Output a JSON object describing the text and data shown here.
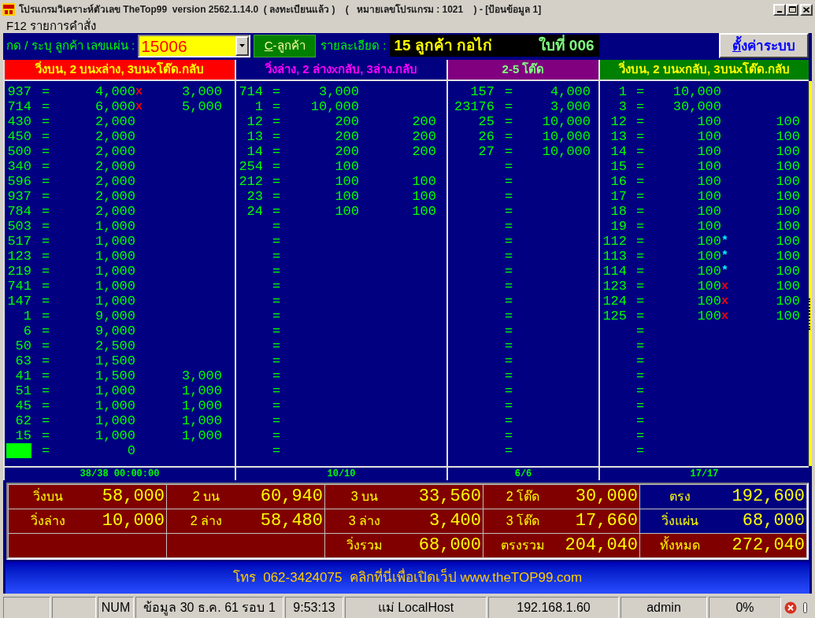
{
  "window": {
    "title": "โปรแกรมวิเคราะห์ตัวเลข TheTop99  version 2562.1.14.0  ( ลงทะเบียนแล้ว )    (   หมายเลขโปรแกรม : 1021    ) - [ป้อนข้อมูล 1]"
  },
  "menu": {
    "label": "F12 รายการคำสั่ง"
  },
  "toolbar": {
    "sheet_label": "กด / ระบุ ลูกค้า เลขแผ่น :",
    "sheet_number": {
      "value": "15006"
    },
    "customer_button": {
      "label": "C-ลูกค้า"
    },
    "detail_label": "รายละเอียด :",
    "detail": {
      "customer": "15 ลูกค้า กอไก่",
      "sheet": "ใบที่ 006"
    },
    "settings_button": {
      "label": "ตั้งค่าระบบ"
    }
  },
  "panels": [
    {
      "title": "วิ่งบน, 2 บนxล่าง, 3บนxโต๊ด.กลับ",
      "color": "#ff0000",
      "rows": [
        {
          "number": "937",
          "sign": "=",
          "amount": "4,000",
          "mark": {
            "symbol": "x",
            "color": "#ff0000"
          },
          "amount_2": "3,000"
        },
        {
          "number": "714",
          "sign": "=",
          "amount": "6,000",
          "mark": {
            "symbol": "x",
            "color": "#ff0000"
          },
          "amount_2": "5,000"
        },
        {
          "number": "430",
          "sign": "=",
          "amount": "2,000"
        },
        {
          "number": "450",
          "sign": "=",
          "amount": "2,000"
        },
        {
          "number": "500",
          "sign": "=",
          "amount": "2,000"
        },
        {
          "number": "340",
          "sign": "=",
          "amount": "2,000"
        },
        {
          "number": "596",
          "sign": "=",
          "amount": "2,000"
        },
        {
          "number": "937",
          "sign": "=",
          "amount": "2,000"
        },
        {
          "number": "784",
          "sign": "=",
          "amount": "2,000"
        },
        {
          "number": "503",
          "sign": "=",
          "amount": "1,000"
        },
        {
          "number": "517",
          "sign": "=",
          "amount": "1,000"
        },
        {
          "number": "123",
          "sign": "=",
          "amount": "1,000"
        },
        {
          "number": "219",
          "sign": "=",
          "amount": "1,000"
        },
        {
          "number": "741",
          "sign": "=",
          "amount": "1,000"
        },
        {
          "number": "147",
          "sign": "=",
          "amount": "1,000"
        },
        {
          "number": "1",
          "sign": "=",
          "amount": "9,000"
        },
        {
          "number": "6",
          "sign": "=",
          "amount": "9,000"
        },
        {
          "number": "50",
          "sign": "=",
          "amount": "2,500"
        },
        {
          "number": "63",
          "sign": "=",
          "amount": "1,500"
        },
        {
          "number": "41",
          "sign": "=",
          "amount": "1,500",
          "amount_2": "3,000"
        },
        {
          "number": "51",
          "sign": "=",
          "amount": "1,000",
          "amount_2": "1,000"
        },
        {
          "number": "45",
          "sign": "=",
          "amount": "1,000",
          "amount_2": "1,000"
        },
        {
          "number": "62",
          "sign": "=",
          "amount": "1,000",
          "amount_2": "1,000"
        },
        {
          "number": "15",
          "sign": "=",
          "amount": "1,000",
          "amount_2": "1,000"
        }
      ],
      "entry": {
        "sign": "=",
        "amount": "0"
      },
      "footer": "38/38 00:00:00"
    },
    {
      "title": "วิ่งล่าง, 2 ล่างxกลับ, 3ล่าง.กลับ",
      "color": "#000080",
      "rows": [
        {
          "number": "714",
          "sign": "=",
          "amount": "3,000"
        },
        {
          "number": "1",
          "sign": "=",
          "amount": "10,000"
        },
        {
          "number": "12",
          "sign": "=",
          "amount": "200",
          "amount_2": "200"
        },
        {
          "number": "13",
          "sign": "=",
          "amount": "200",
          "amount_2": "200"
        },
        {
          "number": "14",
          "sign": "=",
          "amount": "200",
          "amount_2": "200"
        },
        {
          "number": "254",
          "sign": "=",
          "amount": "100"
        },
        {
          "number": "212",
          "sign": "=",
          "amount": "100",
          "amount_2": "100"
        },
        {
          "number": "23",
          "sign": "=",
          "amount": "100",
          "amount_2": "100"
        },
        {
          "number": "24",
          "sign": "=",
          "amount": "100",
          "amount_2": "100"
        },
        {
          "sign": "="
        },
        {
          "sign": "="
        },
        {
          "sign": "="
        },
        {
          "sign": "="
        },
        {
          "sign": "="
        },
        {
          "sign": "="
        },
        {
          "sign": "="
        },
        {
          "sign": "="
        },
        {
          "sign": "="
        },
        {
          "sign": "="
        },
        {
          "sign": "="
        },
        {
          "sign": "="
        },
        {
          "sign": "="
        },
        {
          "sign": "="
        },
        {
          "sign": "="
        },
        {
          "sign": "="
        }
      ],
      "footer": "10/10"
    },
    {
      "title": "2-5 โต๊ด",
      "color": "#800080",
      "rows": [
        {
          "number": "157",
          "sign": "=",
          "amount": "4,000"
        },
        {
          "number": "23176",
          "sign": "=",
          "amount": "3,000"
        },
        {
          "number": "25",
          "sign": "=",
          "amount": "10,000"
        },
        {
          "number": "26",
          "sign": "=",
          "amount": "10,000"
        },
        {
          "number": "27",
          "sign": "=",
          "amount": "10,000"
        },
        {
          "sign": "="
        },
        {
          "sign": "="
        },
        {
          "sign": "="
        },
        {
          "sign": "="
        },
        {
          "sign": "="
        },
        {
          "sign": "="
        },
        {
          "sign": "="
        },
        {
          "sign": "="
        },
        {
          "sign": "="
        },
        {
          "sign": "="
        },
        {
          "sign": "="
        },
        {
          "sign": "="
        },
        {
          "sign": "="
        },
        {
          "sign": "="
        },
        {
          "sign": "="
        },
        {
          "sign": "="
        },
        {
          "sign": "="
        },
        {
          "sign": "="
        },
        {
          "sign": "="
        },
        {
          "sign": "="
        }
      ],
      "footer": "6/6"
    },
    {
      "title": "วิ่งบน, 2 บนxกลับ, 3บนxโต๊ด.กลับ",
      "color": "#008000",
      "rows": [
        {
          "number": "1",
          "sign": "=",
          "amount": "10,000"
        },
        {
          "number": "3",
          "sign": "=",
          "amount": "30,000"
        },
        {
          "number": "12",
          "sign": "=",
          "amount": "100",
          "amount_2": "100"
        },
        {
          "number": "13",
          "sign": "=",
          "amount": "100",
          "amount_2": "100"
        },
        {
          "number": "14",
          "sign": "=",
          "amount": "100",
          "amount_2": "100"
        },
        {
          "number": "15",
          "sign": "=",
          "amount": "100",
          "amount_2": "100"
        },
        {
          "number": "16",
          "sign": "=",
          "amount": "100",
          "amount_2": "100"
        },
        {
          "number": "17",
          "sign": "=",
          "amount": "100",
          "amount_2": "100"
        },
        {
          "number": "18",
          "sign": "=",
          "amount": "100",
          "amount_2": "100"
        },
        {
          "number": "19",
          "sign": "=",
          "amount": "100",
          "amount_2": "100"
        },
        {
          "number": "112",
          "sign": "=",
          "amount": "100",
          "mark": {
            "symbol": "*",
            "color": "#00ffff"
          },
          "amount_2": "100"
        },
        {
          "number": "113",
          "sign": "=",
          "amount": "100",
          "mark": {
            "symbol": "*",
            "color": "#00ffff"
          },
          "amount_2": "100"
        },
        {
          "number": "114",
          "sign": "=",
          "amount": "100",
          "mark": {
            "symbol": "*",
            "color": "#00ffff"
          },
          "amount_2": "100"
        },
        {
          "number": "123",
          "sign": "=",
          "amount": "100",
          "mark": {
            "symbol": "x",
            "color": "#ff0000"
          },
          "amount_2": "100"
        },
        {
          "number": "124",
          "sign": "=",
          "amount": "100",
          "mark": {
            "symbol": "x",
            "color": "#ff0000"
          },
          "amount_2": "100"
        },
        {
          "number": "125",
          "sign": "=",
          "amount": "100",
          "mark": {
            "symbol": "x",
            "color": "#ff0000"
          },
          "amount_2": "100"
        },
        {
          "sign": "="
        },
        {
          "sign": "="
        },
        {
          "sign": "="
        },
        {
          "sign": "="
        },
        {
          "sign": "="
        },
        {
          "sign": "="
        },
        {
          "sign": "="
        },
        {
          "sign": "="
        },
        {
          "sign": "="
        }
      ],
      "footer": "17/17"
    }
  ],
  "totals": [
    [
      {
        "label": "วิ่งบน",
        "value": "58,000",
        "color": "#800000"
      },
      {
        "label": "2 บน",
        "value": "60,940",
        "color": "#800000"
      },
      {
        "label": "3 บน",
        "value": "33,560",
        "color": "#800000"
      },
      {
        "label": "2 โต๊ด",
        "value": "30,000",
        "color": "#800000"
      },
      {
        "label": "ตรง",
        "value": "192,600",
        "color": "#000080"
      }
    ],
    [
      {
        "label": "วิ่งล่าง",
        "value": "10,000",
        "color": "#800000"
      },
      {
        "label": "2 ล่าง",
        "value": "58,480",
        "color": "#800000"
      },
      {
        "label": "3 ล่าง",
        "value": "3,400",
        "color": "#800000"
      },
      {
        "label": "3 โต๊ด",
        "value": "17,660",
        "color": "#800000"
      },
      {
        "label": "วิ่งแผ่น",
        "value": "68,000",
        "color": "#000080"
      }
    ],
    [
      {
        "label": "วิ่งรวม",
        "value": "68,000",
        "color": "#800000"
      },
      {
        "label": "ตรงรวม",
        "value": "204,040",
        "color": "#800000"
      },
      {
        "label": "ทั้งหมด",
        "value": "272,040",
        "color": "#800000"
      }
    ]
  ],
  "banner": {
    "text": "โทร  062-3424075  คลิกที่นี่เพื่อเปิดเว็ป www.theTOP99.com"
  },
  "status_bar": {
    "panels": [
      "NUM",
      "ข้อมูล 30 ธ.ค. 61 รอบ 1",
      "9:53:13",
      "แม่ LocalHost",
      "192.168.1.60",
      "admin",
      "0%"
    ]
  }
}
